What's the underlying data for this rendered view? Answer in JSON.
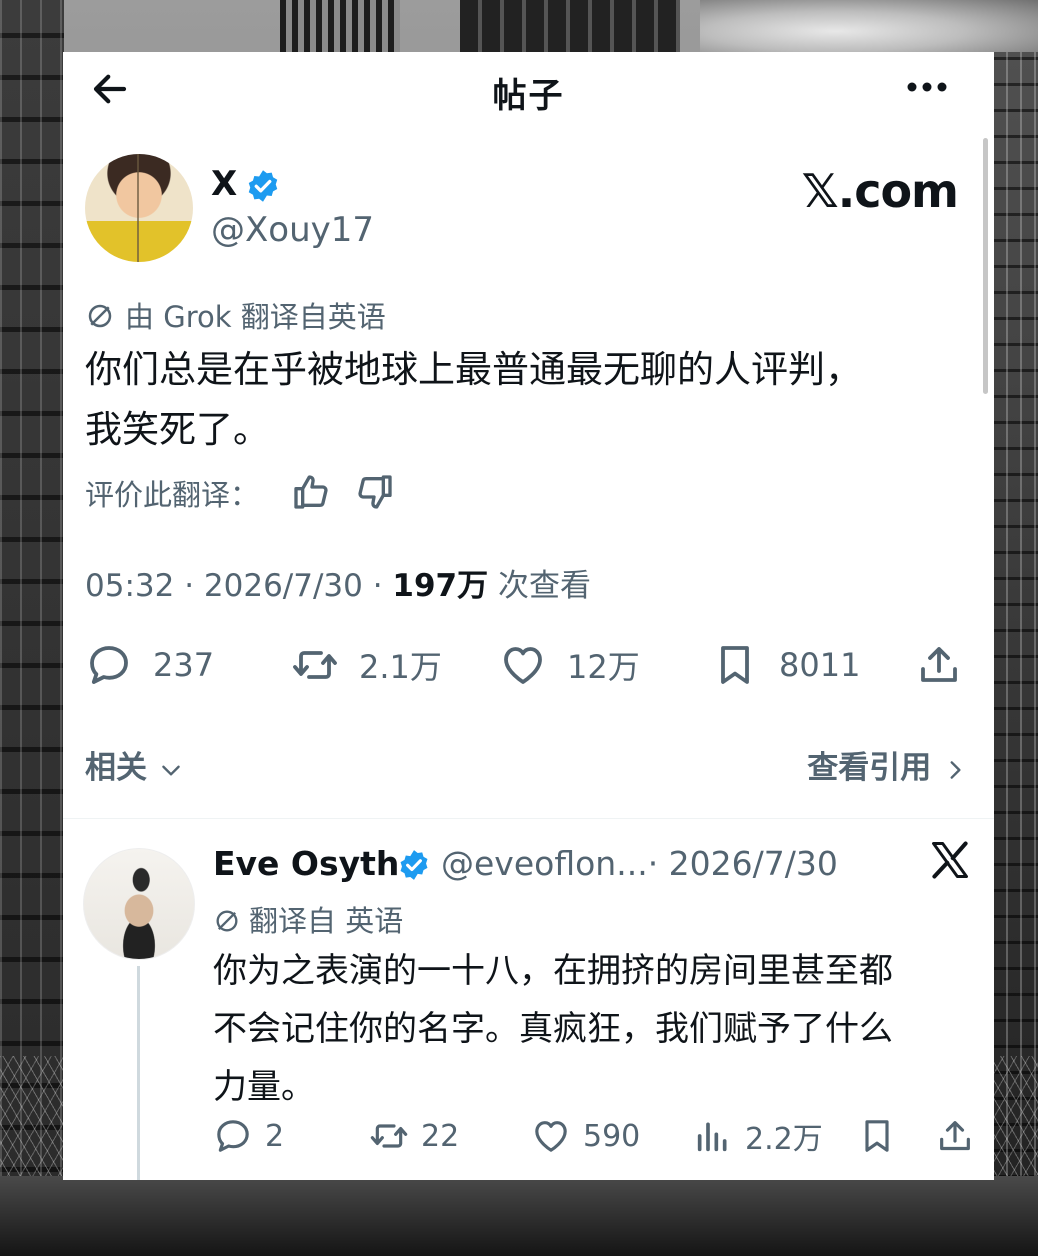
{
  "topbar": {
    "back_icon": "arrow-left-icon",
    "title": "帖子",
    "more_icon": "more-horizontal-icon"
  },
  "post": {
    "author_name": "X",
    "author_handle": "@Xouy17",
    "verified_color": "#1d9bf0",
    "brand_text": "𝕏.com",
    "translation_note": "由 Grok 翻译自英语",
    "text_line1": "你们总是在乎被地球上最普通最无聊的人评判，",
    "text_line2": "我笑死了。",
    "rate_label": "评价此翻译：",
    "time": "05:32 · 2026/7/30 · ",
    "views_count": "197万",
    "views_label": " 次查看",
    "stats": {
      "replies": "237",
      "reposts": "2.1万",
      "likes": "12万",
      "bookmarks": "8011"
    },
    "related_label": "相关",
    "view_quotes_label": "查看引用"
  },
  "reply": {
    "author_name": "Eve Osyth",
    "author_handle": "@eveoflon...",
    "date": "· 2026/7/30",
    "translation_note": "翻译自 英语",
    "text_line1": "你为之表演的一十八，在拥挤的房间里甚至都",
    "text_line2": "不会记住你的名字。真疯狂，我们赋予了什么",
    "text_line3": "力量。",
    "stats": {
      "replies": "2",
      "reposts": "22",
      "likes": "590",
      "views": "2.2万"
    }
  },
  "colors": {
    "text_primary": "#0f1419",
    "text_secondary": "#536471",
    "verified": "#1d9bf0"
  }
}
